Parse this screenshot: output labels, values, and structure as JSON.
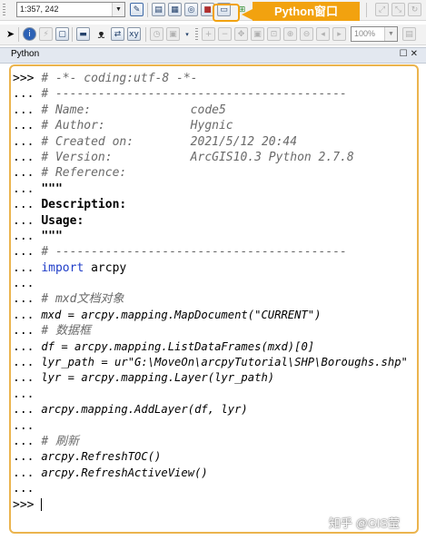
{
  "toolbar": {
    "scale_value": "1:357, 242",
    "zoom_value": "100%"
  },
  "callout": {
    "label": "Python窗口"
  },
  "window": {
    "title": "Python"
  },
  "code_lines": [
    {
      "prompt": ">>> ",
      "text": "# -*- coding:utf-8 -*-",
      "style": "cm"
    },
    {
      "prompt": "... ",
      "text": "# -----------------------------------------",
      "style": "cm"
    },
    {
      "prompt": "... ",
      "text": "# Name:              code5",
      "style": "cm"
    },
    {
      "prompt": "... ",
      "text": "# Author:            Hygnic",
      "style": "cm"
    },
    {
      "prompt": "... ",
      "text": "# Created on:        2021/5/12 20:44",
      "style": "cm"
    },
    {
      "prompt": "... ",
      "text": "# Version:           ArcGIS10.3 Python 2.7.8",
      "style": "cm"
    },
    {
      "prompt": "... ",
      "text": "# Reference:",
      "style": "cm"
    },
    {
      "prompt": "... ",
      "text": "\"\"\"",
      "style": "bd"
    },
    {
      "prompt": "... ",
      "text": "Description:",
      "style": "bd"
    },
    {
      "prompt": "... ",
      "text": "Usage:",
      "style": "bd"
    },
    {
      "prompt": "... ",
      "text": "\"\"\"",
      "style": "bd"
    },
    {
      "prompt": "... ",
      "text": "# -----------------------------------------",
      "style": "cm"
    },
    {
      "prompt": "... ",
      "kw": "import",
      "text": " arcpy",
      "style": "kwline"
    },
    {
      "prompt": "... ",
      "text": "",
      "style": ""
    },
    {
      "prompt": "... ",
      "text": "# mxd文档对象",
      "style": "cm"
    },
    {
      "prompt": "... ",
      "text": "mxd = arcpy.mapping.MapDocument(\"CURRENT\")",
      "style": "lc"
    },
    {
      "prompt": "... ",
      "text": "# 数据框",
      "style": "cm"
    },
    {
      "prompt": "... ",
      "text": "df = arcpy.mapping.ListDataFrames(mxd)[0]",
      "style": "lc"
    },
    {
      "prompt": "... ",
      "text": "lyr_path = ur\"G:\\MoveOn\\arcpyTutorial\\SHP\\Boroughs.shp\"",
      "style": "lc"
    },
    {
      "prompt": "... ",
      "text": "lyr = arcpy.mapping.Layer(lyr_path)",
      "style": "lc"
    },
    {
      "prompt": "... ",
      "text": "",
      "style": ""
    },
    {
      "prompt": "... ",
      "text": "arcpy.mapping.AddLayer(df, lyr)",
      "style": "lc"
    },
    {
      "prompt": "... ",
      "text": "",
      "style": ""
    },
    {
      "prompt": "... ",
      "text": "# 刷新",
      "style": "cm"
    },
    {
      "prompt": "... ",
      "text": "arcpy.RefreshTOC()",
      "style": "lc"
    },
    {
      "prompt": "... ",
      "text": "arcpy.RefreshActiveView()",
      "style": "lc"
    },
    {
      "prompt": "... ",
      "text": "",
      "style": ""
    },
    {
      "prompt": ">>> ",
      "text": "",
      "style": "cursor"
    }
  ],
  "watermark": "知乎 @GIS莹",
  "colors": {
    "callout": "#f2a20f",
    "keyword": "#1f3dc8",
    "frame": "#ebb44e"
  }
}
